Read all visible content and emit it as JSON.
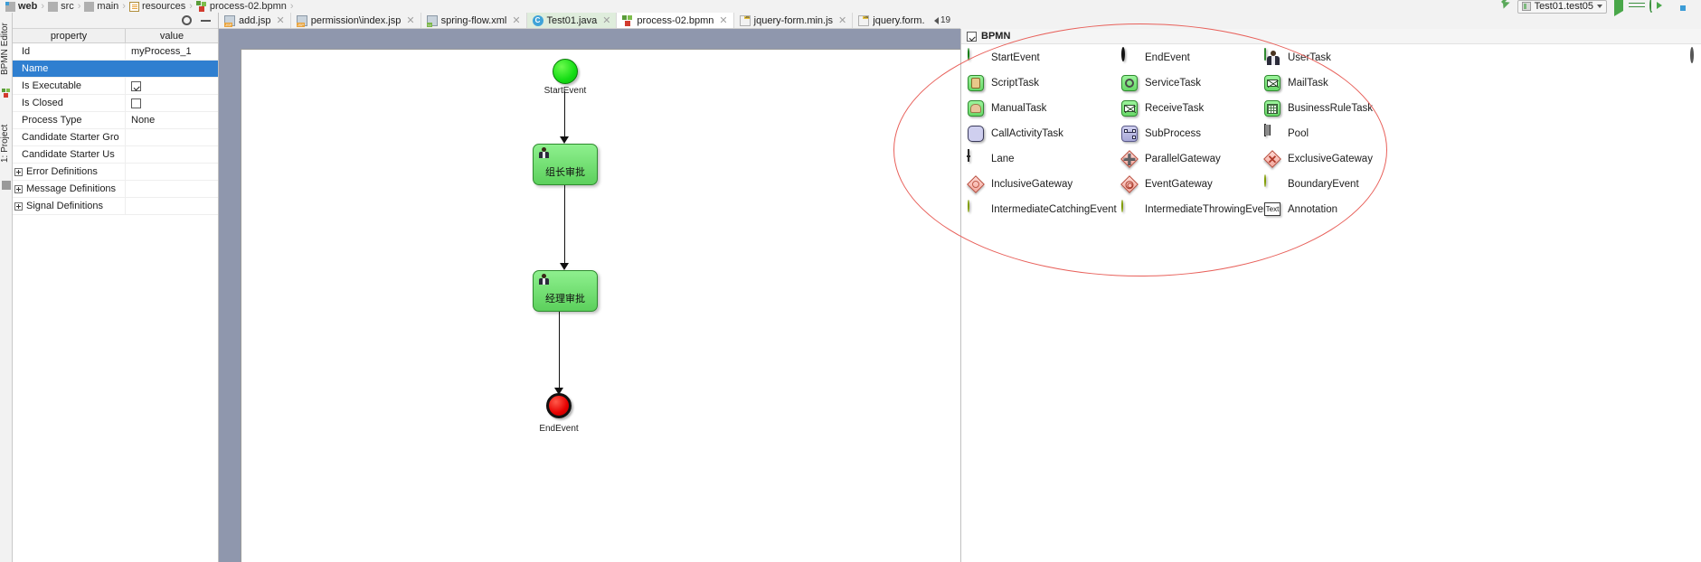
{
  "breadcrumb": [
    {
      "label": "web",
      "icon": "folder-module-icon",
      "bold": true
    },
    {
      "label": "src",
      "icon": "folder-icon",
      "bold": false
    },
    {
      "label": "main",
      "icon": "folder-icon",
      "bold": false
    },
    {
      "label": "resources",
      "icon": "resources-folder-icon",
      "bold": false
    },
    {
      "label": "process-02.bpmn",
      "icon": "bpmn-file-icon",
      "bold": false
    }
  ],
  "breadcrumb_separator": "›",
  "toolbar": {
    "run_config_label": "Test01.test05",
    "run_button": "run-icon",
    "debug_button": "debug-icon",
    "coverage_button": "run-with-coverage-icon",
    "stop_button": "stop-icon",
    "layout_button": "layout-icon",
    "updates_arrow": "green-update-arrow-icon"
  },
  "left_strip": {
    "bpmn_editor_tab": "BPMN Editor",
    "project_tab": "1: Project"
  },
  "properties_panel": {
    "settings_icon": "gear-icon",
    "hide_icon": "minimize-icon",
    "headers": {
      "property": "property",
      "value": "value"
    },
    "rows": [
      {
        "key": "Id",
        "value": "myProcess_1",
        "type": "text",
        "selected": false,
        "group": false
      },
      {
        "key": "Name",
        "value": "",
        "type": "text",
        "selected": true,
        "group": false
      },
      {
        "key": "Is Executable",
        "value": "",
        "type": "checkbox",
        "checked": true,
        "selected": false,
        "group": false
      },
      {
        "key": "Is Closed",
        "value": "",
        "type": "checkbox",
        "checked": false,
        "selected": false,
        "group": false
      },
      {
        "key": "Process Type",
        "value": "None",
        "type": "text",
        "selected": false,
        "group": false
      },
      {
        "key": "Candidate Starter Gro",
        "value": "",
        "type": "text",
        "selected": false,
        "group": false
      },
      {
        "key": "Candidate Starter Us",
        "value": "",
        "type": "text",
        "selected": false,
        "group": false
      },
      {
        "key": "Error Definitions",
        "value": "",
        "type": "text",
        "selected": false,
        "group": true
      },
      {
        "key": "Message Definitions",
        "value": "",
        "type": "text",
        "selected": false,
        "group": true
      },
      {
        "key": "Signal Definitions",
        "value": "",
        "type": "text",
        "selected": false,
        "group": true
      }
    ]
  },
  "editor_tabs": [
    {
      "label": "add.jsp",
      "icon": "jsp-file-icon",
      "state": "inactive",
      "closable": true
    },
    {
      "label": "permission\\index.jsp",
      "icon": "jsp-file-icon",
      "state": "inactive",
      "closable": true
    },
    {
      "label": "spring-flow.xml",
      "icon": "xml-file-icon",
      "state": "inactive",
      "closable": true
    },
    {
      "label": "Test01.java",
      "icon": "java-class-icon",
      "state": "highlighted",
      "closable": true
    },
    {
      "label": "process-02.bpmn",
      "icon": "bpmn-file-icon",
      "state": "active",
      "closable": true
    },
    {
      "label": "jquery-form.min.js",
      "icon": "js-min-file-icon",
      "state": "inactive",
      "closable": true
    },
    {
      "label": "jquery.form.js",
      "icon": "js-file-icon",
      "state": "inactive",
      "closable": true
    }
  ],
  "tab_overflow_label": "19",
  "diagram": {
    "nodes": [
      {
        "id": "startEvent",
        "type": "start-event",
        "label": "StartEvent"
      },
      {
        "id": "task1",
        "type": "user-task",
        "label": "组长审批"
      },
      {
        "id": "task2",
        "type": "user-task",
        "label": "经理审批"
      },
      {
        "id": "endEvent",
        "type": "end-event",
        "label": "EndEvent"
      }
    ]
  },
  "palette": {
    "title": "BPMN",
    "checkbox_checked": true,
    "items": [
      {
        "label": "StartEvent",
        "icon": "start-event-icon",
        "shape": "circle-green"
      },
      {
        "label": "EndEvent",
        "icon": "end-event-icon",
        "shape": "circle-red"
      },
      {
        "label": "UserTask",
        "icon": "user-task-icon",
        "shape": "task-person"
      },
      {
        "label": "ScriptTask",
        "icon": "script-task-icon",
        "shape": "task-scroll"
      },
      {
        "label": "ServiceTask",
        "icon": "service-task-icon",
        "shape": "task-gear"
      },
      {
        "label": "MailTask",
        "icon": "mail-task-icon",
        "shape": "task-envelope"
      },
      {
        "label": "ManualTask",
        "icon": "manual-task-icon",
        "shape": "task-hand"
      },
      {
        "label": "ReceiveTask",
        "icon": "receive-task-icon",
        "shape": "task-envelope-open"
      },
      {
        "label": "BusinessRuleTask",
        "icon": "business-rule-task-icon",
        "shape": "task-table"
      },
      {
        "label": "CallActivityTask",
        "icon": "call-activity-task-icon",
        "shape": "task-plain-lavender"
      },
      {
        "label": "SubProcess",
        "icon": "sub-process-icon",
        "shape": "task-subprocess"
      },
      {
        "label": "Pool",
        "icon": "pool-icon",
        "shape": "pool"
      },
      {
        "label": "Lane",
        "icon": "lane-icon",
        "shape": "lane"
      },
      {
        "label": "ParallelGateway",
        "icon": "parallel-gateway-icon",
        "shape": "diamond-plus"
      },
      {
        "label": "ExclusiveGateway",
        "icon": "exclusive-gateway-icon",
        "shape": "diamond-x"
      },
      {
        "label": "InclusiveGateway",
        "icon": "inclusive-gateway-icon",
        "shape": "diamond-ring"
      },
      {
        "label": "EventGateway",
        "icon": "event-gateway-icon",
        "shape": "diamond-ring2"
      },
      {
        "label": "BoundaryEvent",
        "icon": "boundary-event-icon",
        "shape": "circle-yellow"
      },
      {
        "label": "IntermediateCatchingEvent",
        "icon": "intermediate-catching-event-icon",
        "shape": "circle-yellow"
      },
      {
        "label": "IntermediateThrowingEvent",
        "icon": "intermediate-throwing-event-icon",
        "shape": "circle-yellow"
      },
      {
        "label": "Annotation",
        "icon": "annotation-icon",
        "shape": "text-box"
      }
    ],
    "annotation_text_glyph": "Text"
  },
  "colors": {
    "selection_blue": "#2f7fd0",
    "start_green": "#15dd15",
    "end_red": "#e60000",
    "task_green": "#68d868",
    "annotation_red": "#e8605a",
    "canvas_band": "#8f97ad"
  }
}
